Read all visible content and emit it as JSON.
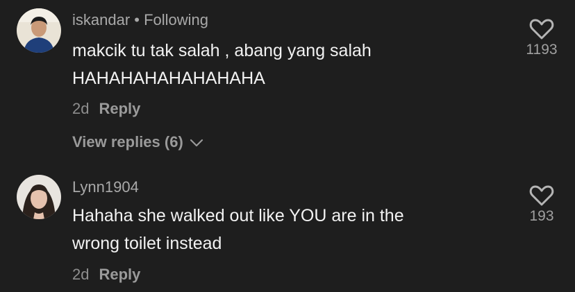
{
  "comments": [
    {
      "username": "iskandar",
      "separator": " • ",
      "badge": "Following",
      "text_lines": [
        "makcik tu tak salah , abang yang salah",
        "HAHAHAHAHAHAHAHA"
      ],
      "time": "2d",
      "reply_label": "Reply",
      "likes": "1193",
      "view_replies": "View replies (6)"
    },
    {
      "username": "Lynn1904",
      "text_lines": [
        "Hahaha she walked out like YOU are in the",
        "wrong toilet instead"
      ],
      "time": "2d",
      "reply_label": "Reply",
      "likes": "193"
    }
  ],
  "icons": {
    "like": "heart-outline-icon",
    "expand": "chevron-down-icon"
  }
}
